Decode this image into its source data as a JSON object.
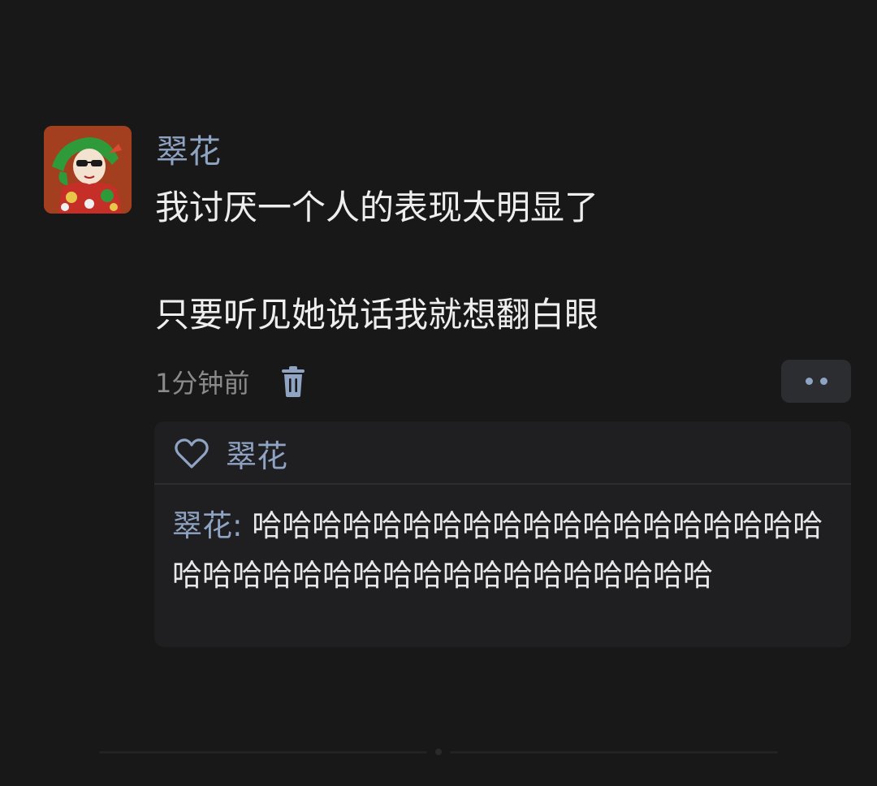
{
  "post": {
    "avatar_icon": "cartoon-avatar-green-headscarf",
    "username": "翠花",
    "content_lines": [
      "我讨厌一个人的表现太明显了",
      "只要听见她说话我就想翻白眼"
    ],
    "time": "1分钟前",
    "delete_icon": "trash-icon",
    "more_icon": "more-dots-icon"
  },
  "likes": {
    "icon": "heart-icon",
    "liker": "翠花"
  },
  "comment": {
    "author": "翠花:",
    "text": "哈哈哈哈哈哈哈哈哈哈哈哈哈哈哈哈哈哈哈哈哈哈哈哈哈哈哈哈哈哈哈哈哈哈哈哈哈"
  },
  "colors": {
    "background": "#181818",
    "username": "#8fa3c2",
    "text": "#eeeeee",
    "muted": "#8a8a8a",
    "panel": "#1f1f21"
  }
}
